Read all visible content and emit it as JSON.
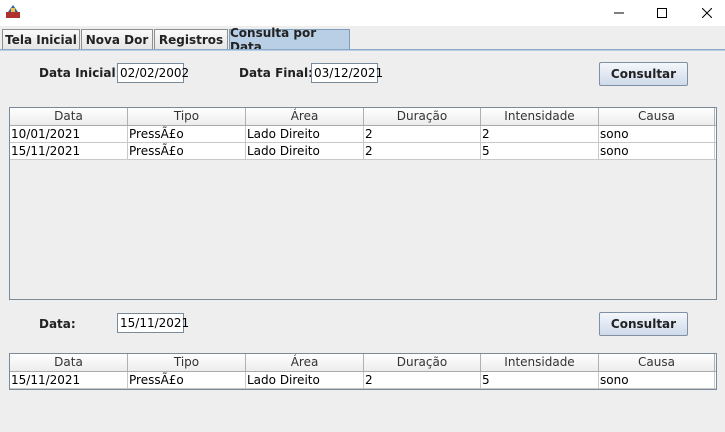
{
  "window": {
    "title": ""
  },
  "tabs": [
    {
      "label": "Tela Inicial"
    },
    {
      "label": "Nova Dor"
    },
    {
      "label": "Registros"
    },
    {
      "label": "Consulta por Data"
    }
  ],
  "filter": {
    "data_inicial_label": "Data Inicial:",
    "data_inicial_value": "02/02/2002",
    "data_final_label": "Data Final:",
    "data_final_value": "03/12/2021",
    "consultar_label": "Consultar"
  },
  "results_table": {
    "columns": [
      "Data",
      "Tipo",
      "Área",
      "Duração",
      "Intensidade",
      "Causa"
    ],
    "rows": [
      [
        "10/01/2021",
        "PressÃ£o",
        "Lado Direito",
        "2",
        "2",
        "sono"
      ],
      [
        "15/11/2021",
        "PressÃ£o",
        "Lado Direito",
        "2",
        "5",
        "sono"
      ]
    ]
  },
  "single": {
    "data_label": "Data:",
    "data_value": "15/11/2021",
    "consultar_label": "Consultar"
  },
  "single_table": {
    "columns": [
      "Data",
      "Tipo",
      "Área",
      "Duração",
      "Intensidade",
      "Causa"
    ],
    "rows": [
      [
        "15/11/2021",
        "PressÃ£o",
        "Lado Direito",
        "2",
        "5",
        "sono"
      ]
    ]
  }
}
